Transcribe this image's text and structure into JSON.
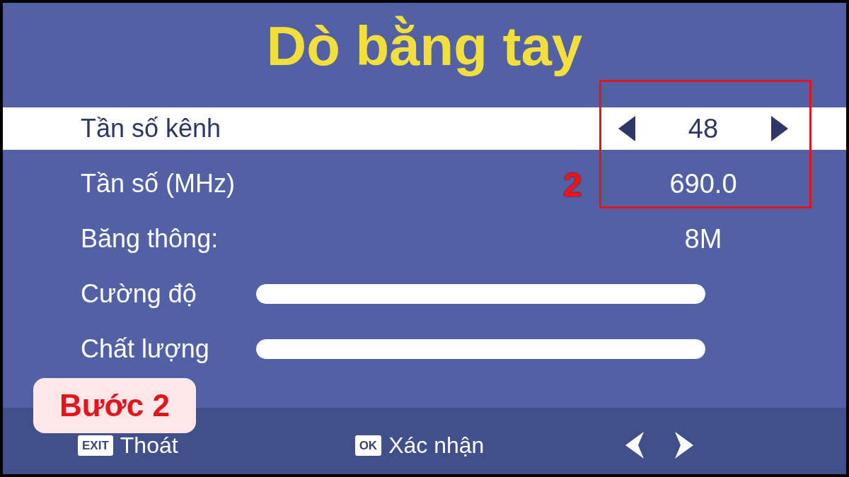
{
  "title": "Dò bằng tay",
  "rows": [
    {
      "kind": "select",
      "label": "Tần số kênh",
      "value": "48",
      "selected": true
    },
    {
      "kind": "value",
      "label": "Tần số (MHz)",
      "value": "690.0",
      "selected": false
    },
    {
      "kind": "value",
      "label": "Băng thông:",
      "value": "8M",
      "selected": false
    },
    {
      "kind": "meter",
      "label": "Cường độ",
      "level": 1,
      "selected": false
    },
    {
      "kind": "meter",
      "label": "Chất lượng",
      "level": 1,
      "selected": false
    }
  ],
  "annotation": {
    "number": "2",
    "step": "Bước 2"
  },
  "footer": [
    {
      "kind": "key",
      "key": "EXIT",
      "label": "Thoát"
    },
    {
      "kind": "key",
      "key": "OK",
      "label": "Xác nhận"
    },
    {
      "kind": "arrows"
    }
  ]
}
